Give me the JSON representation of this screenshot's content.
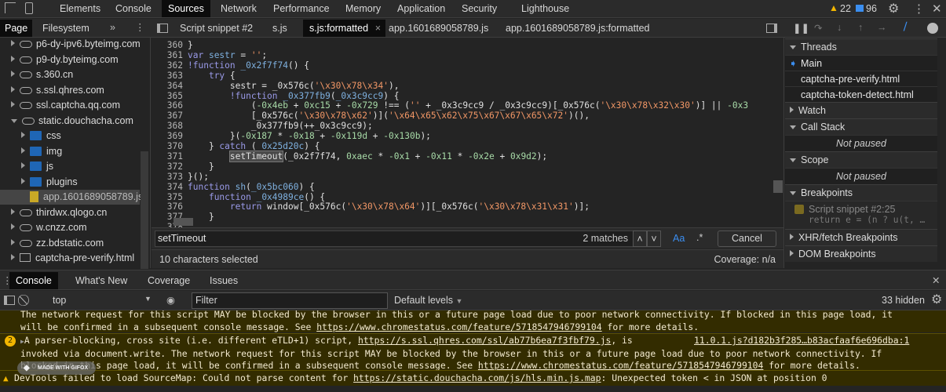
{
  "main_tabs": [
    "Elements",
    "Console",
    "Sources",
    "Network",
    "Performance",
    "Memory",
    "Application",
    "Security",
    "Lighthouse"
  ],
  "selected_main_tab": "Sources",
  "counters": {
    "warnings": "22",
    "messages": "96"
  },
  "navigator_tabs": [
    "Page",
    "Filesystem"
  ],
  "editor_tabs": [
    "Script snippet #2",
    "s.js",
    "s.js:formatted",
    "app.1601689058789.js",
    "app.1601689058789.js:formatted"
  ],
  "tree": [
    {
      "label": "p6-dy-ipv6.byteimg.com",
      "type": "domain"
    },
    {
      "label": "p9-dy.byteimg.com",
      "type": "domain"
    },
    {
      "label": "s.360.cn",
      "type": "domain"
    },
    {
      "label": "s.ssl.qhres.com",
      "type": "domain"
    },
    {
      "label": "ssl.captcha.qq.com",
      "type": "domain"
    },
    {
      "label": "static.douchacha.com",
      "type": "domain-open"
    },
    {
      "label": "css",
      "type": "folder"
    },
    {
      "label": "img",
      "type": "folder"
    },
    {
      "label": "js",
      "type": "folder"
    },
    {
      "label": "plugins",
      "type": "folder"
    },
    {
      "label": "app.1601689058789.js",
      "type": "file"
    },
    {
      "label": "thirdwx.qlogo.cn",
      "type": "domain"
    },
    {
      "label": "w.cnzz.com",
      "type": "domain"
    },
    {
      "label": "zz.bdstatic.com",
      "type": "domain"
    },
    {
      "label": "captcha-pre-verify.html",
      "type": "frame"
    }
  ],
  "code": [
    {
      "n": "360",
      "t": [
        [
          "op",
          "}"
        ]
      ]
    },
    {
      "n": "361",
      "t": [
        [
          "kw",
          "var "
        ],
        [
          "id",
          "sestr"
        ],
        [
          "op",
          " = "
        ],
        [
          "str",
          "''"
        ],
        [
          "op",
          ";"
        ]
      ]
    },
    {
      "n": "362",
      "t": [
        [
          "kw",
          "!function "
        ],
        [
          "id",
          "_0x2f7f74"
        ],
        [
          "op",
          "() {"
        ]
      ]
    },
    {
      "n": "363",
      "t": [
        [
          "op",
          "    "
        ],
        [
          "kw",
          "try"
        ],
        [
          "op",
          " {"
        ]
      ]
    },
    {
      "n": "364",
      "t": [
        [
          "op",
          "        sestr = _0x576c("
        ],
        [
          "str",
          "'\\x30\\x78\\x34'"
        ],
        [
          "op",
          "),"
        ]
      ]
    },
    {
      "n": "365",
      "t": [
        [
          "op",
          "        "
        ],
        [
          "kw",
          "!function "
        ],
        [
          "id",
          "_0x377fb9"
        ],
        [
          "op",
          "("
        ],
        [
          "id",
          "_0x3c9cc9"
        ],
        [
          "op",
          ") {"
        ]
      ]
    },
    {
      "n": "366",
      "t": [
        [
          "op",
          "            ("
        ],
        [
          "num",
          "-0x4eb"
        ],
        [
          "op",
          " + "
        ],
        [
          "num",
          "0xc15"
        ],
        [
          "op",
          " + "
        ],
        [
          "num",
          "-0x729"
        ],
        [
          "op",
          " !== ("
        ],
        [
          "str",
          "''"
        ],
        [
          "op",
          " + _0x3c9cc9 / _0x3c9cc9)[_0x576c("
        ],
        [
          "str",
          "'\\x30\\x78\\x32\\x30'"
        ],
        [
          "op",
          ")] || "
        ],
        [
          "num",
          "-0x3"
        ]
      ]
    },
    {
      "n": "367",
      "t": [
        [
          "op",
          "            [_0x576c("
        ],
        [
          "str",
          "'\\x30\\x78\\x62'"
        ],
        [
          "op",
          ")]("
        ],
        [
          "str",
          "'\\x64\\x65\\x62\\x75\\x67\\x67\\x65\\x72'"
        ],
        [
          "op",
          ")(),"
        ]
      ]
    },
    {
      "n": "368",
      "t": [
        [
          "op",
          "            _0x377fb9(++_0x3c9cc9);"
        ]
      ]
    },
    {
      "n": "369",
      "t": [
        [
          "op",
          "        }("
        ],
        [
          "num",
          "-0x187"
        ],
        [
          "op",
          " * "
        ],
        [
          "num",
          "-0x18"
        ],
        [
          "op",
          " + "
        ],
        [
          "num",
          "-0x119d"
        ],
        [
          "op",
          " + "
        ],
        [
          "num",
          "-0x130b"
        ],
        [
          "op",
          ");"
        ]
      ]
    },
    {
      "n": "370",
      "t": [
        [
          "op",
          "    } "
        ],
        [
          "kw",
          "catch"
        ],
        [
          "op",
          " ( "
        ],
        [
          "id",
          "0x25d20c"
        ],
        [
          "op",
          ") {"
        ]
      ]
    },
    {
      "n": "371",
      "t": [
        [
          "op",
          "        "
        ],
        [
          "hl",
          "setTimeout"
        ],
        [
          "op",
          "(_0x2f7f74, "
        ],
        [
          "num",
          "0xaec"
        ],
        [
          "op",
          " * "
        ],
        [
          "num",
          "-0x1"
        ],
        [
          "op",
          " + "
        ],
        [
          "num",
          "-0x11"
        ],
        [
          "op",
          " * "
        ],
        [
          "num",
          "-0x2e"
        ],
        [
          "op",
          " + "
        ],
        [
          "num",
          "0x9d2"
        ],
        [
          "op",
          ");"
        ]
      ]
    },
    {
      "n": "372",
      "t": [
        [
          "op",
          "    }"
        ]
      ]
    },
    {
      "n": "373",
      "t": [
        [
          "op",
          "}();"
        ]
      ]
    },
    {
      "n": "374",
      "t": [
        [
          "kw",
          "function "
        ],
        [
          "id",
          "sh"
        ],
        [
          "op",
          "("
        ],
        [
          "id",
          "_0x5bc060"
        ],
        [
          "op",
          ") {"
        ]
      ]
    },
    {
      "n": "375",
      "t": [
        [
          "op",
          "    "
        ],
        [
          "kw",
          "function "
        ],
        [
          "id",
          "_0x4989ce"
        ],
        [
          "op",
          "() {"
        ]
      ]
    },
    {
      "n": "376",
      "t": [
        [
          "op",
          "        "
        ],
        [
          "kw",
          "return "
        ],
        [
          "op",
          "window[_0x576c("
        ],
        [
          "str",
          "'\\x30\\x78\\x64'"
        ],
        [
          "op",
          ")][_0x576c("
        ],
        [
          "str",
          "'\\x30\\x78\\x31\\x31'"
        ],
        [
          "op",
          ")];"
        ]
      ]
    },
    {
      "n": "377",
      "t": [
        [
          "op",
          "    }"
        ]
      ]
    },
    {
      "n": "378",
      "t": [
        [
          "op",
          ""
        ]
      ]
    }
  ],
  "search": {
    "value": "setTimeout",
    "matches": "2 matches",
    "case_label": "Aa",
    "regex_label": ".*",
    "cancel": "Cancel"
  },
  "status": {
    "selection": "10 characters selected",
    "coverage": "Coverage: n/a"
  },
  "debugger": {
    "threads": "Threads",
    "thread_items": [
      "Main",
      "captcha-pre-verify.html",
      "captcha-token-detect.html"
    ],
    "watch": "Watch",
    "call_stack": "Call Stack",
    "scope": "Scope",
    "not_paused": "Not paused",
    "breakpoints": "Breakpoints",
    "bp_name": "Script snippet #2:25",
    "bp_code": "return e = (n ? u(t, …",
    "xhr": "XHR/fetch Breakpoints",
    "dom": "DOM Breakpoints"
  },
  "drawer_tabs": [
    "Console",
    "What's New",
    "Coverage",
    "Issues"
  ],
  "console": {
    "context": "top",
    "filter_placeholder": "Filter",
    "levels": "Default levels",
    "hidden": "33 hidden"
  },
  "messages": {
    "m1_l1": "The network request for this script MAY be blocked by the browser in this or a future page load due to poor network connectivity. If blocked in this page load, it",
    "m1_l2a": "will be confirmed in a subsequent console message. See ",
    "m1_link": "https://www.chromestatus.com/feature/5718547946799104",
    "m1_l2b": " for more details.",
    "m2_count": "2",
    "m2_l1a": "A parser-blocking, cross site (i.e. different eTLD+1) script, ",
    "m2_link1": "https://s.ssl.qhres.com/ssl/ab77b6ea7f3fbf79.js",
    "m2_l1b": ", is",
    "m2_source": "11.0.1.js?d182b3f285…b83acfaaf6e696dba:1",
    "m2_l2": "invoked via document.write. The network request for this script MAY be blocked by the browser in this or a future page load due to poor network connectivity. If",
    "m2_l3a": "blocked in this page load, it will be confirmed in a subsequent console message. See ",
    "m2_link2": "https://www.chromestatus.com/feature/5718547946799104",
    "m2_l3b": " for more details.",
    "m3a": "DevTools failed to load SourceMap: Could not parse content for ",
    "m3_link": "https://static.douchacha.com/js/hls.min.js.map",
    "m3b": ": Unexpected token < in JSON at position 0"
  },
  "watermark": "MADE WITH GIFOX"
}
